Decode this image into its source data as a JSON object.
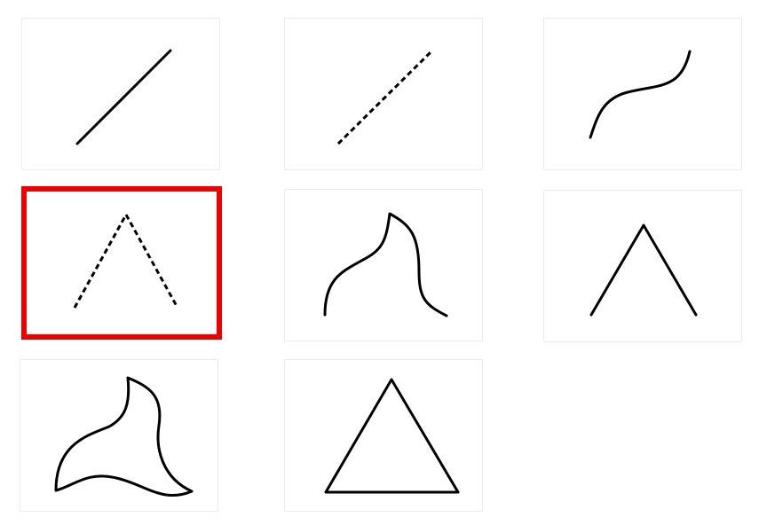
{
  "tiles": [
    {
      "shape": "straight-line",
      "style": "solid",
      "selected": false
    },
    {
      "shape": "straight-line",
      "style": "dashed",
      "selected": false
    },
    {
      "shape": "s-curve",
      "style": "solid",
      "selected": false
    },
    {
      "shape": "caret-open-angle",
      "style": "dashed",
      "selected": true
    },
    {
      "shape": "curved-bump",
      "style": "solid",
      "selected": false
    },
    {
      "shape": "caret-open-angle",
      "style": "solid",
      "selected": false
    },
    {
      "shape": "curved-triangle",
      "style": "solid",
      "selected": false
    },
    {
      "shape": "triangle",
      "style": "solid",
      "selected": false
    }
  ],
  "colors": {
    "selection_border": "#ee0000",
    "tile_border": "#ececec",
    "stroke": "#000000"
  }
}
